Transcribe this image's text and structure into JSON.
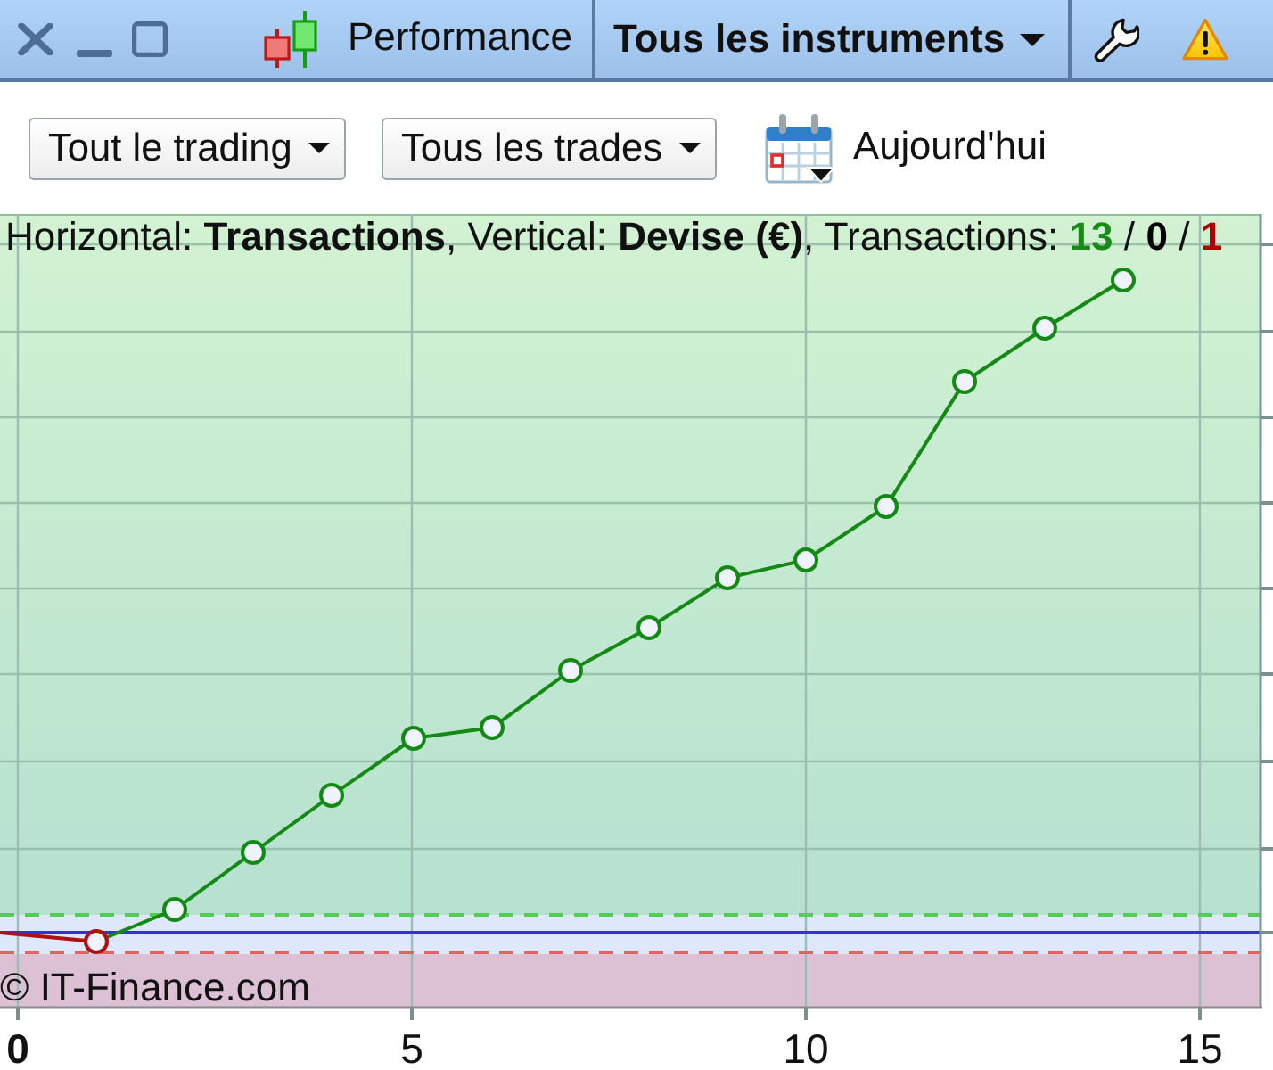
{
  "window": {
    "title": "Performance",
    "instrument_filter": "Tous les instruments"
  },
  "filters": [
    {
      "label": "Tout le trading"
    },
    {
      "label": "Tous les trades"
    }
  ],
  "date_button": {
    "label": "Aujourd'hui"
  },
  "chart": {
    "info": "Horizontal: **Transactions**, Vertical: **Devise (€)**, Transactions:",
    "counts": [
      {
        "value": "13",
        "color": "#178a17"
      },
      {
        "value": "0",
        "color": "#000000"
      },
      {
        "value": "1",
        "color": "#b00000"
      }
    ],
    "separators": [
      "/",
      "/"
    ],
    "x_ticks": [
      {
        "label": "0",
        "kind": "origin"
      },
      {
        "label": "5",
        "kind": "tick"
      },
      {
        "label": "10",
        "kind": "tick"
      },
      {
        "label": "15",
        "kind": "tick"
      }
    ],
    "credit": "© IT-Finance.com"
  }
}
